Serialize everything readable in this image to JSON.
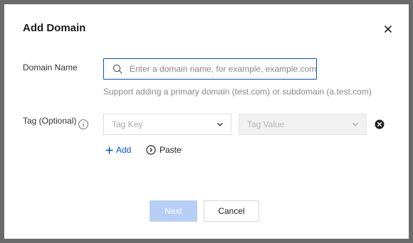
{
  "dialog": {
    "title": "Add Domain",
    "close_icon": "close-icon"
  },
  "form": {
    "domain_label": "Domain Name",
    "domain_placeholder": "Enter a domain name, for example, example.com",
    "domain_value": "",
    "domain_help": "Support adding a primary domain (test.com) or subdomain (a.test.com)",
    "tag_label": "Tag (Optional)",
    "tag_key_placeholder": "Tag Key",
    "tag_value_placeholder": "Tag Value",
    "add_label": "Add",
    "paste_label": "Paste"
  },
  "footer": {
    "next_label": "Next",
    "cancel_label": "Cancel"
  },
  "colors": {
    "primary": "#0052d9",
    "disabled_primary": "#b7cff7",
    "overlay": "#6b6b6b"
  },
  "icons": [
    "close-icon",
    "search-icon",
    "info-icon",
    "chevron-down-icon",
    "remove-icon",
    "plus-icon",
    "paste-icon"
  ]
}
